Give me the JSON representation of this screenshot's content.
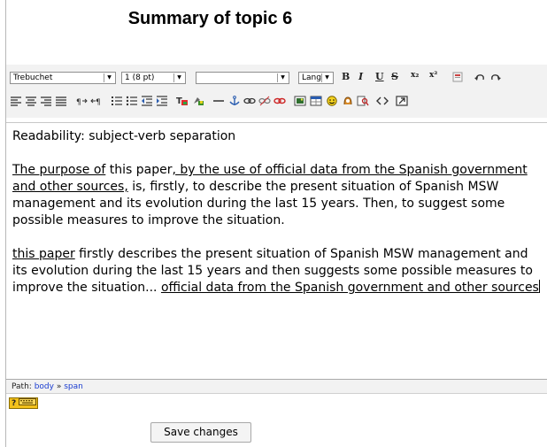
{
  "page_title": "Summary of topic 6",
  "toolbar": {
    "font_family": "Trebuchet",
    "font_size": "1 (8 pt)",
    "style": "",
    "language": "Lang",
    "bold": "B",
    "italic": "I",
    "underline": "U",
    "strikethrough": "S",
    "subscript": "x₂",
    "superscript": "x²"
  },
  "editor": {
    "heading_line": "Readability: subject-verb separation",
    "para1_a": "The purpose of",
    "para1_b": " this paper",
    "para1_c": ", by the use of official data from the Spanish government and other sources,",
    "para1_d": " is, firstly, to describe the present situation of Spanish MSW management and its evolution during the last 15 years. Then, to suggest some possible measures to improve the situation.",
    "para2_a": "this paper",
    "para2_b": " firstly describes the present situation of Spanish MSW management and its evolution during the last 15 years and then suggests some possible measures to improve the situation... ",
    "para2_c": "official data from the Spanish government and other sources"
  },
  "path_bar": {
    "label": "Path:",
    "item1": "body",
    "separator": "»",
    "item2": "span"
  },
  "help_icon": "?",
  "save_button": "Save changes"
}
